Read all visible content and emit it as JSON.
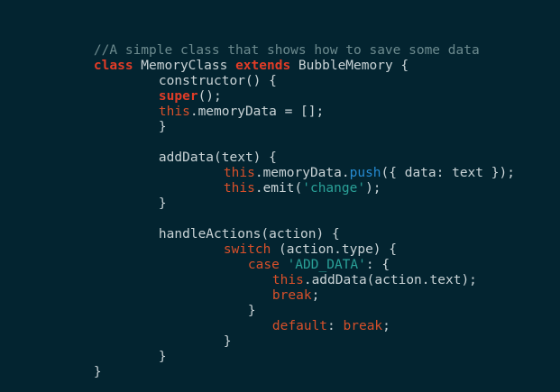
{
  "colors": {
    "background": "#032430",
    "text": "#c9d3d6",
    "comment": "#6c8a8e",
    "keyword_red": "#e23c27",
    "keyword_orange": "#d8502a",
    "string": "#2aa198",
    "method_blue": "#268bd2"
  },
  "code": {
    "comment_line": "//A simple class that shows how to save some data",
    "class_kw": "class",
    "class_name": " MemoryClass ",
    "extends_kw": "extends",
    "parent_class": " BubbleMemory {",
    "constructor_sig": "constructor() {",
    "super_kw": "super",
    "super_call": "();",
    "this_kw": "this",
    "memory_init": ".memoryData = [];",
    "close_brace": "}",
    "add_data_sig": "addData(text) {",
    "memory_data_ref": ".memoryData.",
    "push_method": "push",
    "push_args": "({ data: text });",
    "emit_call": ".emit(",
    "change_str": "'change'",
    "emit_end": ");",
    "handle_actions_sig": "handleActions(action) {",
    "switch_kw": "switch",
    "switch_expr": " (action.type) {",
    "case_kw": "case",
    "add_data_str": " 'ADD_DATA'",
    "case_colon": ": {",
    "add_data_call": ".addData(action.text);",
    "break_kw": "break",
    "semicolon": ";",
    "default_kw": "default",
    "default_colon": ": "
  }
}
